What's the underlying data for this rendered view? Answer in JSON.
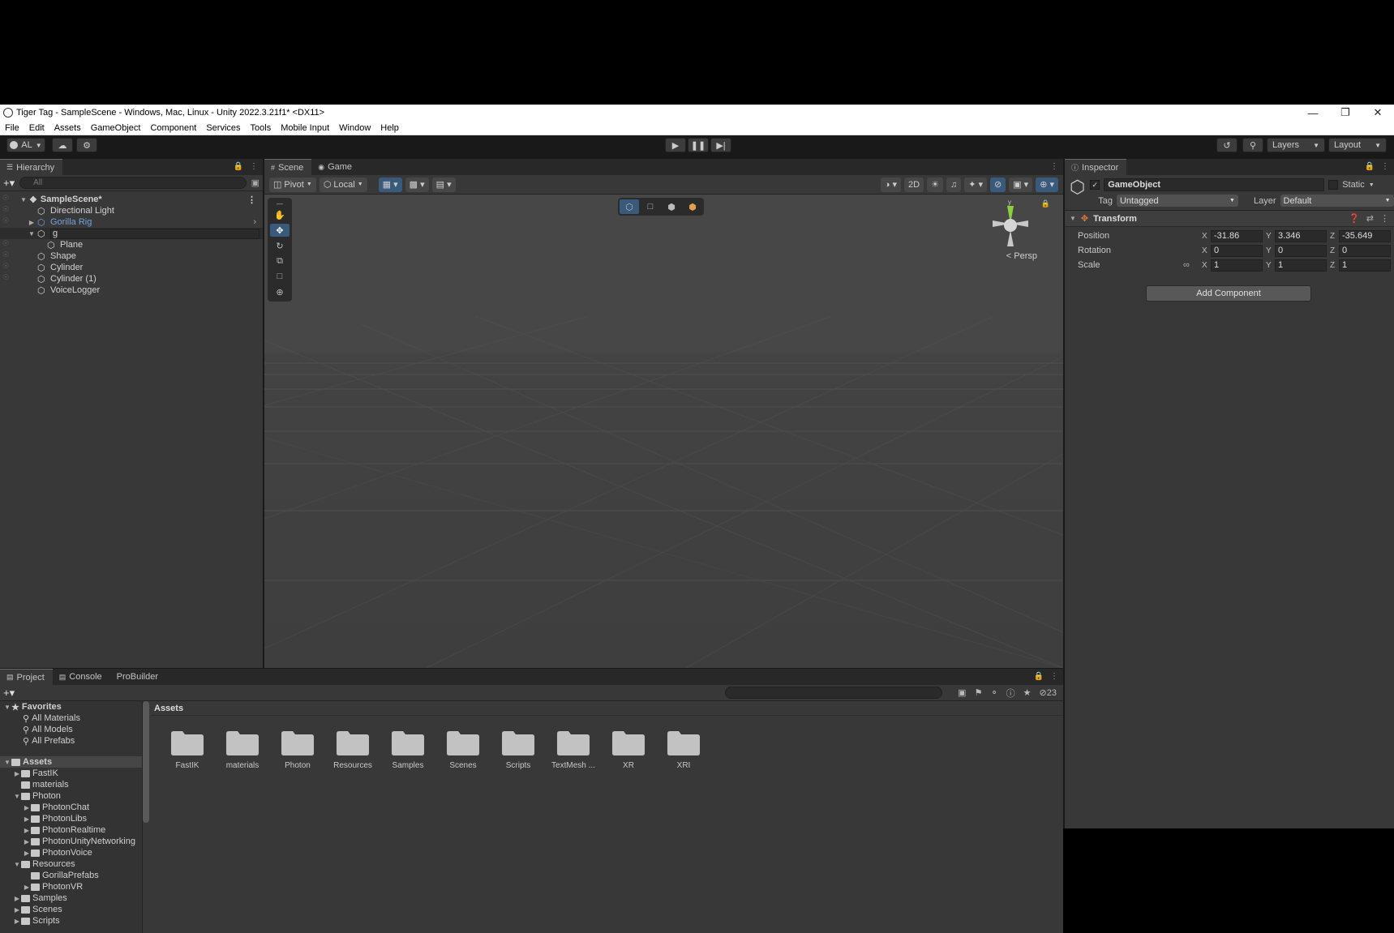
{
  "window": {
    "title": "Tiger Tag - SampleScene - Windows, Mac, Linux - Unity 2022.3.21f1* <DX11>"
  },
  "menu": [
    "File",
    "Edit",
    "Assets",
    "GameObject",
    "Component",
    "Services",
    "Tools",
    "Mobile Input",
    "Window",
    "Help"
  ],
  "toolbar": {
    "account": "AL",
    "layers_label": "Layers",
    "layout_label": "Layout"
  },
  "hierarchy": {
    "tab_label": "Hierarchy",
    "search_placeholder": "All",
    "scene_name": "SampleScene*",
    "items": [
      {
        "label": "Directional Light"
      },
      {
        "label": "Gorilla Rig"
      },
      {
        "label": "g"
      },
      {
        "label": "Plane"
      },
      {
        "label": "Shape"
      },
      {
        "label": "Cylinder"
      },
      {
        "label": "Cylinder (1)"
      },
      {
        "label": "VoiceLogger"
      }
    ]
  },
  "scene": {
    "tabs": [
      "Scene",
      "Game"
    ],
    "pivot_label": "Pivot",
    "local_label": "Local",
    "mode_2d": "2D",
    "persp_label": "Persp",
    "gizmo_y": "y"
  },
  "inspector": {
    "tab_label": "Inspector",
    "object_name": "GameObject",
    "static_label": "Static",
    "tag_label": "Tag",
    "tag_value": "Untagged",
    "layer_label": "Layer",
    "layer_value": "Default",
    "transform_label": "Transform",
    "position_label": "Position",
    "rotation_label": "Rotation",
    "scale_label": "Scale",
    "position": {
      "x": "-31.86",
      "y": "3.346",
      "z": "-35.649"
    },
    "rotation": {
      "x": "0",
      "y": "0",
      "z": "0"
    },
    "scale": {
      "x": "1",
      "y": "1",
      "z": "1"
    },
    "add_component": "Add Component"
  },
  "project": {
    "tabs": [
      "Project",
      "Console",
      "ProBuilder"
    ],
    "hidden_count": "23",
    "favorites_label": "Favorites",
    "favorites": [
      "All Materials",
      "All Models",
      "All Prefabs"
    ],
    "assets_label": "Assets",
    "tree": [
      {
        "label": "FastIK"
      },
      {
        "label": "materials"
      },
      {
        "label": "Photon"
      },
      {
        "label": "PhotonChat"
      },
      {
        "label": "PhotonLibs"
      },
      {
        "label": "PhotonRealtime"
      },
      {
        "label": "PhotonUnityNetworking"
      },
      {
        "label": "PhotonVoice"
      },
      {
        "label": "Resources"
      },
      {
        "label": "GorillaPrefabs"
      },
      {
        "label": "PhotonVR"
      },
      {
        "label": "Samples"
      },
      {
        "label": "Scenes"
      },
      {
        "label": "Scripts"
      }
    ],
    "breadcrumb": "Assets",
    "folders": [
      "FastIK",
      "materials",
      "Photon",
      "Resources",
      "Samples",
      "Scenes",
      "Scripts",
      "TextMesh ...",
      "XR",
      "XRI"
    ]
  }
}
